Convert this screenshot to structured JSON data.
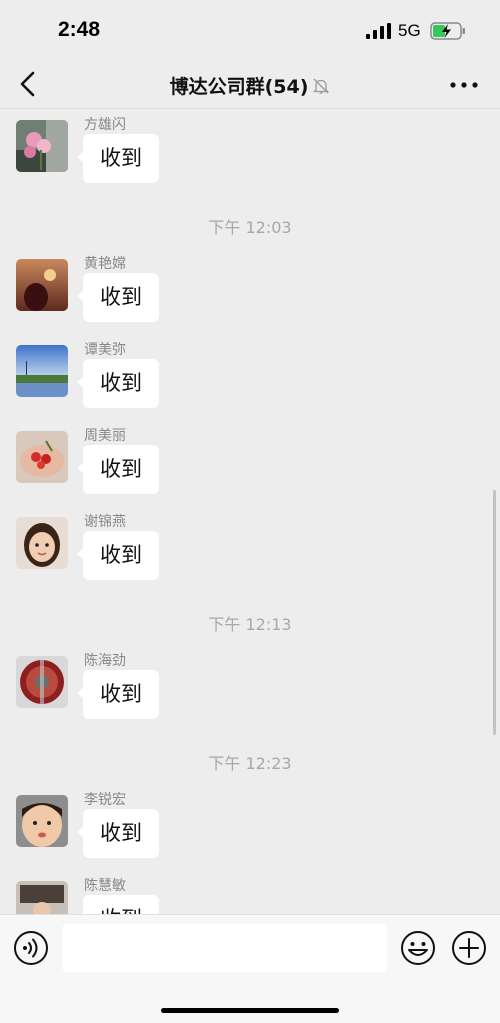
{
  "status_bar": {
    "time": "2:48",
    "network": "5G"
  },
  "nav": {
    "title": "博达公司群(54)",
    "back_icon": "back-chevron-icon",
    "mute_icon": "bell-off-icon",
    "more_icon": "more-dots-icon"
  },
  "chat": {
    "messages": [
      {
        "sender": "方雄闪",
        "text": "收到"
      },
      {
        "timestamp": "下午 12:03"
      },
      {
        "sender": "黄艳嫦",
        "text": "收到"
      },
      {
        "sender": "谭美弥",
        "text": "收到"
      },
      {
        "sender": "周美丽",
        "text": "收到"
      },
      {
        "sender": "谢锦燕",
        "text": "收到"
      },
      {
        "timestamp": "下午 12:13"
      },
      {
        "sender": "陈海劲",
        "text": "收到"
      },
      {
        "timestamp": "下午 12:23"
      },
      {
        "sender": "李锐宏",
        "text": "收到"
      },
      {
        "sender": "陈慧敏",
        "text": "收到"
      }
    ]
  },
  "input_bar": {
    "voice_icon": "voice-icon",
    "text_value": "",
    "emoji_icon": "emoji-icon",
    "plus_icon": "plus-circle-icon"
  },
  "colors": {
    "background": "#ededed",
    "bubble": "#ffffff",
    "sender_text": "#888888",
    "timestamp_text": "#a8a8a8"
  }
}
